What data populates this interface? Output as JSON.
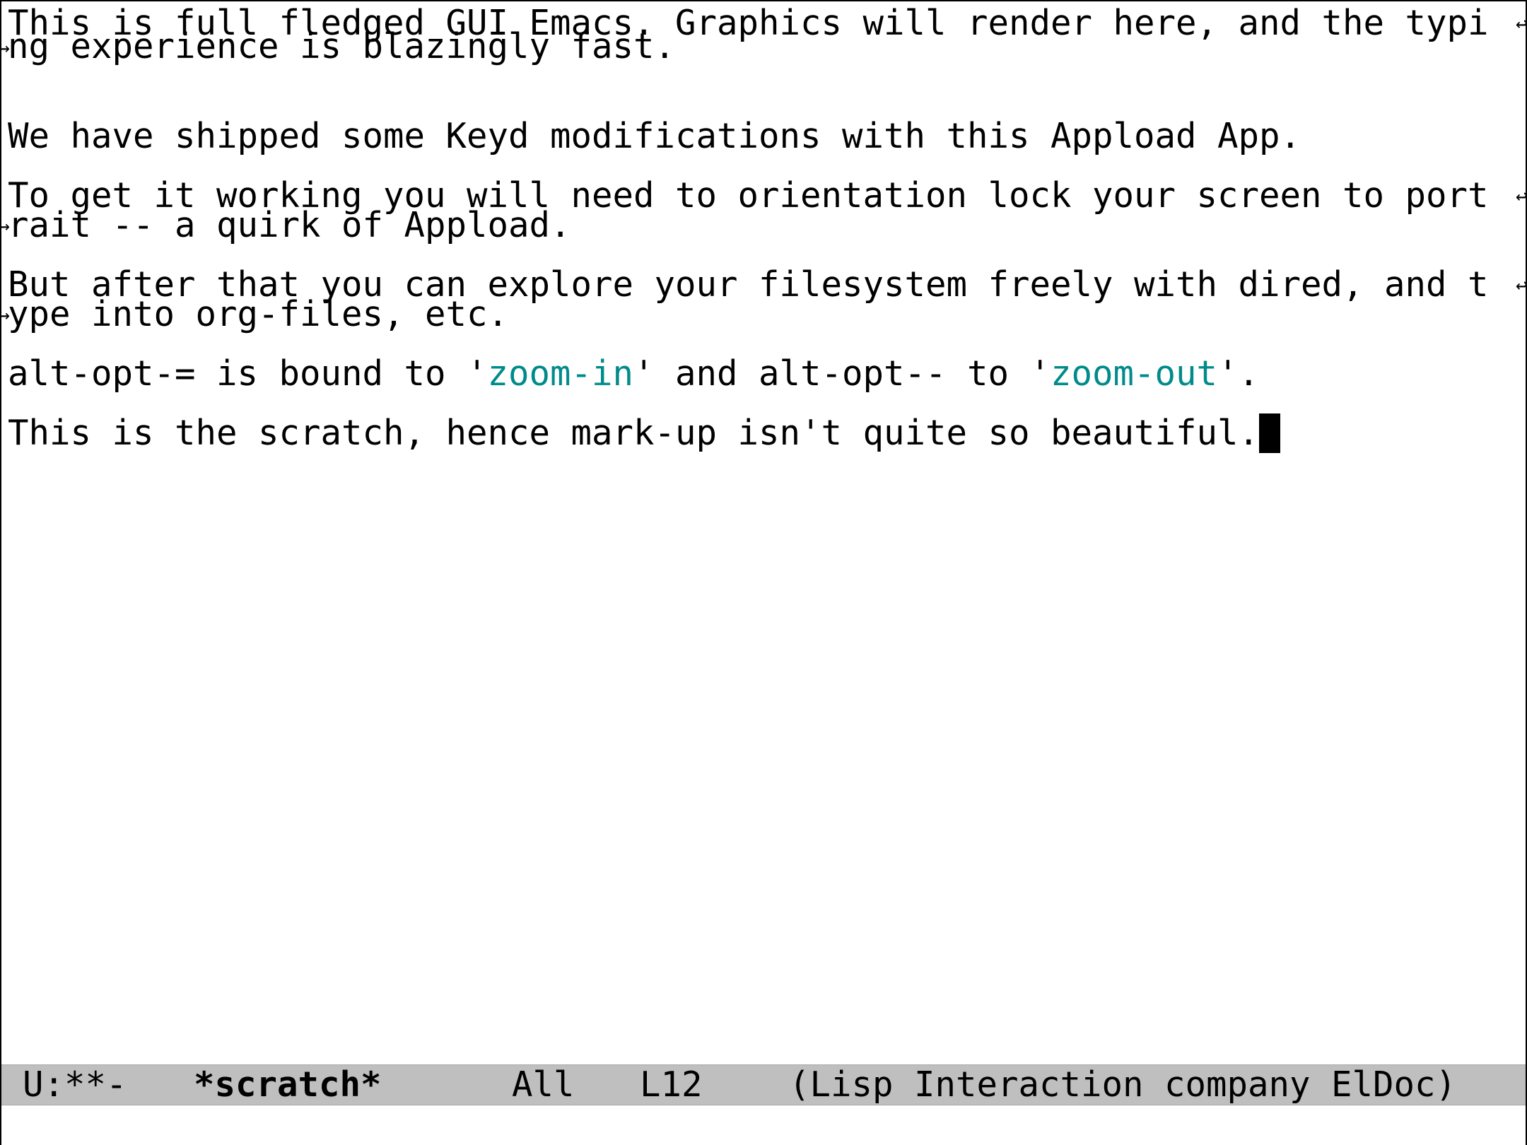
{
  "buffer": {
    "lines": [
      "This is full fledged GUI Emacs. Graphics will render here, and the typi",
      "ng experience is blazingly fast.",
      "We have shipped some Keyd modifications with this Appload App.",
      "To get it working you will need to orientation lock your screen to port",
      "rait -- a quirk of Appload.",
      "But after that you can explore your filesystem freely with dired, and t",
      "ype into org-files, etc."
    ],
    "zoom_line": {
      "part1": "alt-opt-= is bound to '",
      "fn1": "zoom-in",
      "part2": "' and alt-opt-- to '",
      "fn2": "zoom-out",
      "part3": "'."
    },
    "last_line": "This is the scratch, hence mark-up isn't quite so beautiful."
  },
  "fringe": {
    "continuation_glyph": "↩",
    "link_color": "#008b8b"
  },
  "modeline": {
    "status": "U:**-",
    "buffer_name": "*scratch*",
    "position": "All",
    "line": "L12",
    "modes": "(Lisp Interaction company ElDoc)",
    "background": "#bfbfbf"
  },
  "minibuffer": {
    "text": ""
  }
}
